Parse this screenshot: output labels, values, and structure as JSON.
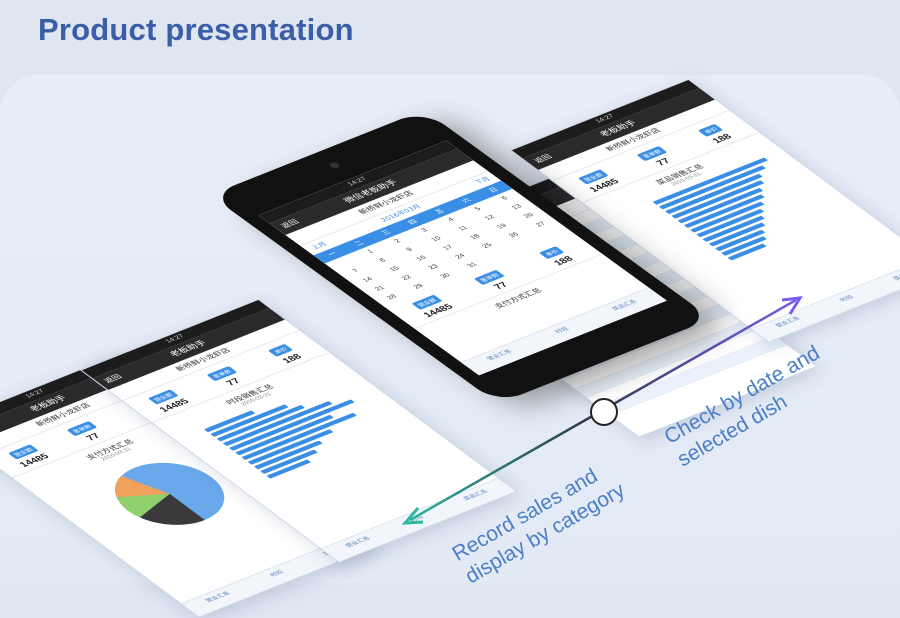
{
  "page": {
    "title": "Product presentation"
  },
  "screens": {
    "status": "14:27",
    "nav_title": "老板助手",
    "nav_title_alt": "微信老板助手",
    "back": "返回",
    "shop": "新桥鲜小龙虾店",
    "kpis": [
      {
        "label": "营业额",
        "value": "14485"
      },
      {
        "label": "客单数",
        "value": "77"
      },
      {
        "label": "单价",
        "value": "188"
      }
    ],
    "pie_title": "支付方式汇总",
    "bar_title": "时段销售汇总",
    "dish_title": "菜品销售汇总",
    "date": "2016-03-31",
    "tabs": [
      "营业汇总",
      "时段",
      "菜品汇总"
    ]
  },
  "calendar": {
    "month": "2016年03月",
    "prev": "上月",
    "next": "下月",
    "weekdays": [
      "一",
      "二",
      "三",
      "四",
      "五",
      "六",
      "日"
    ],
    "days": [
      "",
      "1",
      "2",
      "3",
      "4",
      "5",
      "6",
      "7",
      "8",
      "9",
      "10",
      "11",
      "12",
      "13",
      "14",
      "15",
      "16",
      "17",
      "18",
      "19",
      "20",
      "21",
      "22",
      "23",
      "24",
      "25",
      "26",
      "27",
      "28",
      "29",
      "30",
      "31",
      "",
      "",
      "",
      ""
    ],
    "summary_title": "支付方式汇总"
  },
  "bars": {
    "times": [
      0.35,
      0.55,
      0.62,
      0.78,
      0.9,
      0.7,
      0.82,
      0.6,
      0.48,
      0.4,
      0.3
    ],
    "dishes": [
      0.95,
      0.88,
      0.8,
      0.76,
      0.7,
      0.66,
      0.6,
      0.55,
      0.5,
      0.45,
      0.4,
      0.36,
      0.3
    ]
  },
  "arrow": {
    "label_left": [
      "Record sales and",
      "display by category"
    ],
    "label_right": [
      "Check by date and",
      "selected dish"
    ],
    "left_color": "#2fb8a0",
    "right_color": "#7a5cf0"
  }
}
